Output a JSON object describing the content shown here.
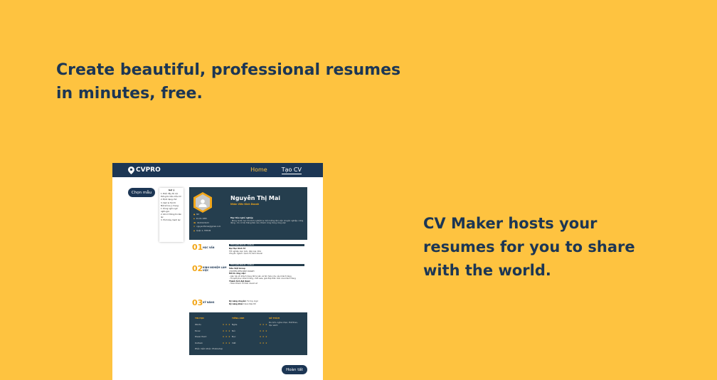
{
  "hero": {
    "headline": "Create beautiful, professional resumes in minutes, free.",
    "subline": "CV Maker hosts your resumes for you to share with the world."
  },
  "colors": {
    "background": "#FEC340",
    "navy": "#1C3654",
    "accent": "#F2A618"
  },
  "app": {
    "brand": "CVPRO",
    "brand_icon": "location-pin-icon",
    "nav": [
      {
        "label": "Home"
      },
      {
        "label": "Tạo CV",
        "active": true
      }
    ],
    "choose_template": "Chọn mẫu",
    "finish": "Hoàn tất"
  },
  "tips": {
    "title": "Gợi ý",
    "items": [
      "1. Điền đầy đủ các thông tin trên mẫu CV",
      "2. Định dạng chữ",
      "3. Xem & Tải CV",
      "Một số lưu ý chung:",
      "1. Dùng ngôn ngữ ngắn gọn",
      "2. Ghi rõ thông tin liên lạc",
      "3. Trình bày mạch lạc"
    ]
  },
  "cv": {
    "name": "Nguyễn Thị Mai",
    "title": "Nhân Viên Kinh Doanh",
    "contact": [
      {
        "icon": "user-icon",
        "text": "Nữ"
      },
      {
        "icon": "calendar-icon",
        "text": "01-01-1995"
      },
      {
        "icon": "phone-icon",
        "text": "0123123123"
      },
      {
        "icon": "mail-icon",
        "text": "nguyenthimai@gmail.com"
      },
      {
        "icon": "location-icon",
        "text": "Quận 1, TPHCM"
      }
    ],
    "goal_label": "Mục tiêu nghề nghiệp",
    "goal_text": "- Mong muốn học hỏi kinh nghiệm & môi trường làm việc chuyên nghiệp, năng động - Có cơ hội thăng tiến cao, thành công trong công việc",
    "sections": [
      {
        "num": "01",
        "label": "HỌC VẤN",
        "bar": "THỜI GIAN  2013-01 - 2016-01",
        "lines": [
          {
            "bold": "Đại Học Kinh Tế"
          },
          {
            "text": "Tốt nghiệp loại: Giỏi, Xếp loại: Khá"
          },
          {
            "text": "Chuyên ngành: Quản Trị Kinh Doanh"
          }
        ]
      },
      {
        "num": "02",
        "label": "KINH NGHIỆM LÀM VIỆC",
        "bar": "THỜI GIAN  2016-01 - 2018-12",
        "lines": [
          {
            "bold": "Siêu Việt Group"
          },
          {
            "text": "CHUYÊN VIÊN KINH DOANH"
          },
          {
            "bold": "Mô tả công việc:"
          },
          {
            "text": "- Liên hệ với khách hàng để tư vấn và tìm hiểu nhu cầu khách hàng"
          },
          {
            "text": "- Thuyết phục khách hàng, chốt sale, giải đáp thắc mắc của khách hàng"
          },
          {
            "bold": "Thành tích đạt được:"
          },
          {
            "text": "- Hoàn thành chỉ tiêu doanh số"
          }
        ]
      },
      {
        "num": "03",
        "label": "KỸ NĂNG",
        "lines": [
          {
            "bold": "Kỹ năng chuyên:",
            "text": "Tư duy logic"
          },
          {
            "bold": "Kỹ năng khác:",
            "text": "Giao tiếp tốt"
          }
        ]
      }
    ],
    "skills": {
      "tin_hoc": {
        "head": "TIN HỌC",
        "rows": [
          {
            "name": "Words",
            "stars": "★ ★ ★"
          },
          {
            "name": "Excel",
            "stars": "★ ★ ★"
          },
          {
            "name": "Power Point",
            "stars": "★ ★ ★"
          },
          {
            "name": "Outlook",
            "stars": "★ ★ ★"
          }
        ]
      },
      "tieng_anh": {
        "head": "TIẾNG ANH",
        "rows": [
          {
            "name": "Nghe",
            "stars": "★ ★ ★"
          },
          {
            "name": "Nói",
            "stars": "★ ★ ★"
          },
          {
            "name": "Đọc",
            "stars": "★ ★ ★"
          },
          {
            "name": "Viết",
            "stars": "★ ★ ★"
          }
        ]
      },
      "so_thich": {
        "head": "SỞ THÍCH",
        "text": "Du lịch, nghe nhạc, thể thao, đọc sách"
      },
      "other": "Phần mềm khác: Photoshop"
    }
  }
}
